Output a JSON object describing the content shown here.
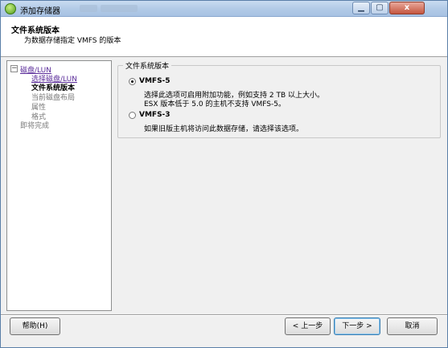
{
  "window": {
    "title": "添加存储器",
    "close_symbol": "x"
  },
  "header": {
    "title": "文件系统版本",
    "subtitle": "为数据存储指定 VMFS 的版本"
  },
  "nav": {
    "items": [
      {
        "label": "磁盘/LUN",
        "state": "link"
      },
      {
        "label": "选择磁盘/LUN",
        "state": "link"
      },
      {
        "label": "文件系统版本",
        "state": "current"
      },
      {
        "label": "当前磁盘布局",
        "state": "disabled"
      },
      {
        "label": "属性",
        "state": "disabled"
      },
      {
        "label": "格式",
        "state": "disabled"
      },
      {
        "label": "即将完成",
        "state": "disabled"
      }
    ],
    "expander_symbol": "−"
  },
  "group": {
    "title": "文件系统版本",
    "options": [
      {
        "label": "VMFS-5",
        "checked": true,
        "desc_lines": [
          "选择此选项可启用附加功能，例如支持 2 TB 以上大小。",
          "ESX 版本低于 5.0 的主机不支持 VMFS-5。"
        ]
      },
      {
        "label": "VMFS-3",
        "checked": false,
        "desc_lines": [
          "如果旧版主机将访问此数据存储，请选择该选项。"
        ]
      }
    ]
  },
  "buttons": {
    "help": "帮助(H)",
    "back": "< 上一步",
    "next": "下一步 >",
    "cancel": "取消"
  }
}
